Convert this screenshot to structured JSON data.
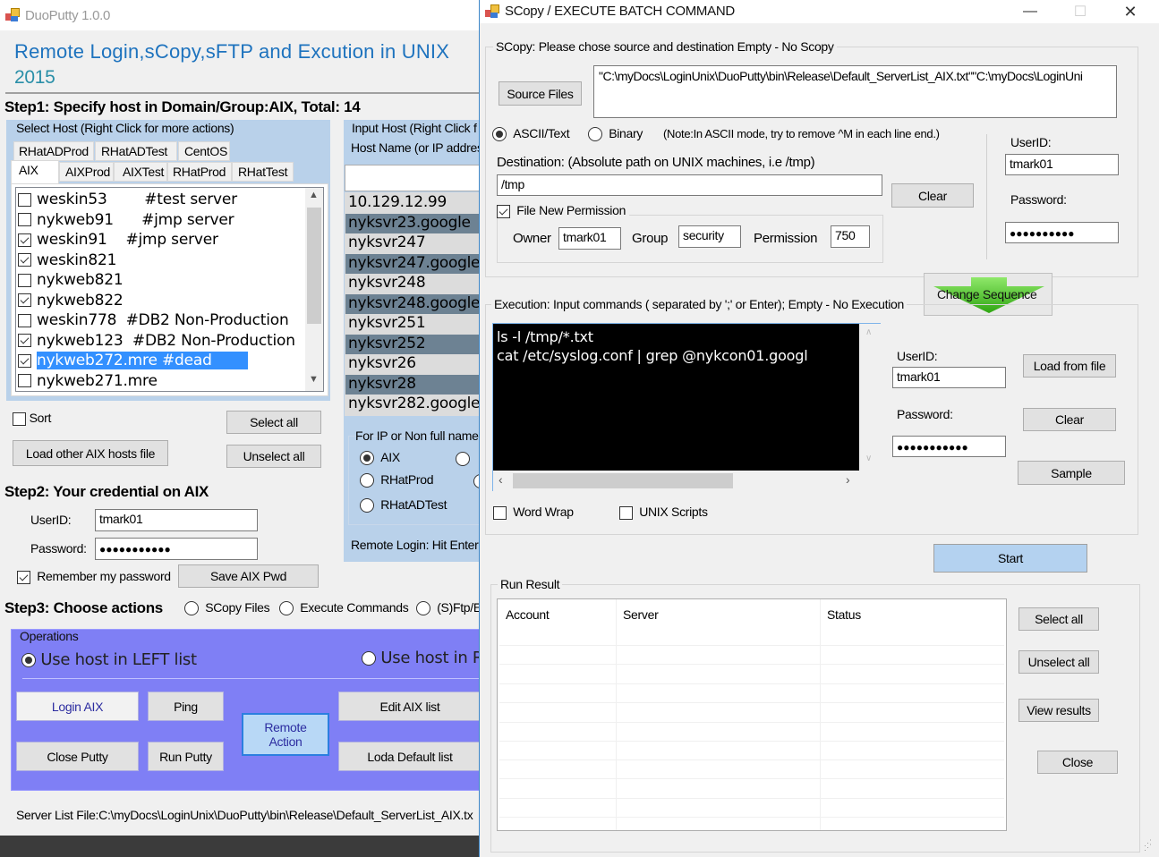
{
  "left_window": {
    "title": "DuoPutty 1.0.0",
    "header_line1": "Remote Login,sCopy,sFTP and Excution in UNIX",
    "header_line2": "2015",
    "step1_title": "Step1: Specify host in Domain/Group:AIX, Total: 14",
    "select_host": {
      "group_title": "Select Host (Right Click for more actions)",
      "tabs_row1": [
        "RHatADProd",
        "RHatADTest",
        "CentOS"
      ],
      "tabs_row2": [
        "AIX",
        "AIXProd",
        "AIXTest",
        "RHatProd",
        "RHatTest"
      ],
      "active_tab": "AIX",
      "hosts": [
        {
          "name": "weskin53",
          "comment": "#test server",
          "checked": false,
          "selected": false
        },
        {
          "name": "nykweb91",
          "comment": "#jmp server",
          "checked": false,
          "selected": false
        },
        {
          "name": "weskin91",
          "comment": "#jmp server",
          "checked": true,
          "selected": false
        },
        {
          "name": "weskin821",
          "comment": "",
          "checked": true,
          "selected": false
        },
        {
          "name": "nykweb821",
          "comment": "",
          "checked": false,
          "selected": false
        },
        {
          "name": "nykweb822",
          "comment": "",
          "checked": true,
          "selected": false
        },
        {
          "name": "weskin778",
          "comment": "#DB2 Non-Production",
          "checked": false,
          "selected": false
        },
        {
          "name": "nykweb123",
          "comment": "#DB2 Non-Production",
          "checked": true,
          "selected": false
        },
        {
          "name": "nykweb272.mre",
          "comment": "#dead",
          "checked": true,
          "selected": true
        },
        {
          "name": "nykweb271.mre",
          "comment": "",
          "checked": false,
          "selected": false
        }
      ],
      "sort_label": "Sort",
      "sort_checked": false,
      "select_all": "Select all",
      "unselect_all": "Unselect all",
      "load_file": "Load other AIX hosts file"
    },
    "input_host": {
      "group_title": "Input Host (Right Click f",
      "host_name_label": "Host Name (or IP addres",
      "host_name_value": "",
      "list": [
        "10.129.12.99",
        "nyksvr23.google",
        "nyksvr247",
        "nyksvr247.google",
        "nyksvr248",
        "nyksvr248.google",
        "nyksvr251",
        "nyksvr252",
        "nyksvr26",
        "nyksvr28",
        "nyksvr282.google"
      ],
      "non_full_title": "For IP or Non full name",
      "radios": [
        {
          "label": "AIX",
          "checked": true
        },
        {
          "label": "RHatProd",
          "checked": false
        },
        {
          "label": "RHatADTest",
          "checked": false
        }
      ],
      "remote_login_hint": "Remote Login: Hit Enter"
    },
    "step2": {
      "title": "Step2: Your credential on AIX",
      "userid_label": "UserID:",
      "userid_value": "tmark01",
      "password_label": "Password:",
      "password_value": "●●●●●●●●●●●",
      "remember_label": "Remember my password",
      "remember_checked": true,
      "save_button": "Save AIX Pwd"
    },
    "step3": {
      "title": "Step3: Choose actions",
      "options": [
        "SCopy Files",
        "Execute Commands",
        "(S)Ftp/E"
      ]
    },
    "operations": {
      "group_title": "Operations",
      "use_left": "Use host in LEFT list",
      "use_right": "Use host in R",
      "use_left_checked": true,
      "buttons": {
        "login": "Login AIX",
        "ping": "Ping",
        "remote_action": "Remote Action",
        "edit_list": "Edit AIX list",
        "close_putty": "Close Putty",
        "run_putty": "Run Putty",
        "load_default": "Loda Default list"
      }
    },
    "server_list_file": "Server List File:C:\\myDocs\\LoginUnix\\DuoPutty\\bin\\Release\\Default_ServerList_AIX.tx"
  },
  "right_window": {
    "title": "SCopy / EXECUTE BATCH COMMAND",
    "controls": {
      "minimize": "—",
      "maximize": "☐",
      "close": "✕"
    },
    "scopy": {
      "group_title": "SCopy:  Please chose source and destination      Empty - No Scopy",
      "source_button": "Source Files",
      "source_value": "\"C:\\myDocs\\LoginUnix\\DuoPutty\\bin\\Release\\Default_ServerList_AIX.txt\"\"C:\\myDocs\\LoginUni",
      "mode_ascii": "ASCII/Text",
      "mode_binary": "Binary",
      "mode_selected": "ASCII/Text",
      "note": "(Note:In ASCII mode, try to remove ^M in each line end.)",
      "destination_label": "Destination:   (Absolute path on UNIX machines, i.e /tmp)",
      "destination_value": "/tmp",
      "clear_button": "Clear",
      "file_perm_label": "File New Permission",
      "file_perm_checked": true,
      "owner_label": "Owner",
      "owner_value": "tmark01",
      "group_label": "Group",
      "group_value": "security",
      "permission_label": "Permission",
      "permission_value": "750",
      "userid_label": "UserID:",
      "userid_value": "tmark01",
      "password_label": "Password:",
      "password_value": "●●●●●●●●●●"
    },
    "change_sequence": "Change Sequence",
    "execution": {
      "group_title": "Execution: Input commands ( separated  by ';' or Enter);  Empty - No Execution",
      "commands": [
        "ls -l /tmp/*.txt",
        "cat /etc/syslog.conf | grep @nykcon01.googl"
      ],
      "userid_label": "UserID:",
      "userid_value": "tmark01",
      "password_label": "Password:",
      "password_value": "●●●●●●●●●●●",
      "load_from_file": "Load from file",
      "clear": "Clear",
      "sample": "Sample",
      "word_wrap": "Word Wrap",
      "word_wrap_checked": false,
      "unix_scripts": "UNIX Scripts",
      "unix_scripts_checked": false
    },
    "start_button": "Start",
    "run_result": {
      "group_title": "Run Result",
      "columns": [
        "Account",
        "Server",
        "Status"
      ],
      "rows": [],
      "select_all": "Select all",
      "unselect_all": "Unselect all",
      "view_results": "View results",
      "close": "Close"
    }
  },
  "colors": {
    "header_blue": "#1e73be",
    "panel_blue": "#b9d1ea",
    "operations_purple": "#7f7ff5",
    "selection_blue": "#3390ff",
    "alt_row_gray": "#6d8293",
    "start_button": "#b4d2f0",
    "change_sequence_green": "#3cc81e"
  }
}
